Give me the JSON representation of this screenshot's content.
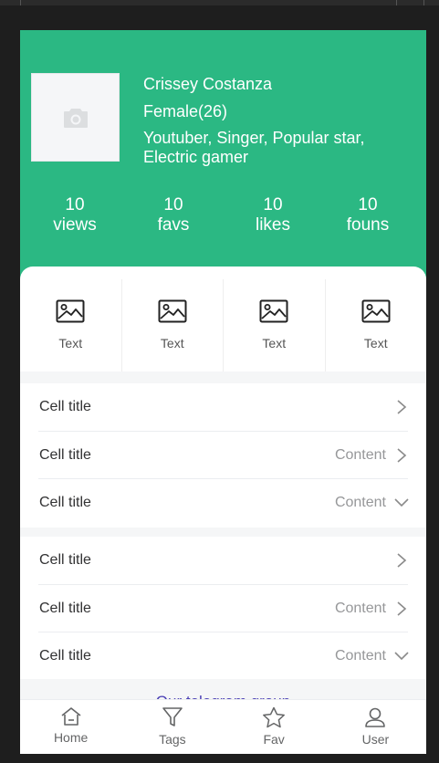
{
  "profile": {
    "avatar_icon": "camera-icon",
    "name": "Crissey Costanza",
    "gender": "Female(26)",
    "tags": "Youtuber, Singer, Popular star, Electric gamer"
  },
  "stats": [
    {
      "value": "10",
      "label": "views"
    },
    {
      "value": "10",
      "label": "favs"
    },
    {
      "value": "10",
      "label": "likes"
    },
    {
      "value": "10",
      "label": "founs"
    }
  ],
  "grid": [
    {
      "icon": "image-icon",
      "label": "Text"
    },
    {
      "icon": "image-icon",
      "label": "Text"
    },
    {
      "icon": "image-icon",
      "label": "Text"
    },
    {
      "icon": "image-icon",
      "label": "Text"
    }
  ],
  "cell_groups": [
    [
      {
        "title": "Cell title",
        "value": "",
        "arrow": "chevron-right-icon"
      },
      {
        "title": "Cell title",
        "value": "Content",
        "arrow": "chevron-right-icon"
      },
      {
        "title": "Cell title",
        "value": "Content",
        "arrow": "chevron-down-icon"
      }
    ],
    [
      {
        "title": "Cell title",
        "value": "",
        "arrow": "chevron-right-icon"
      },
      {
        "title": "Cell title",
        "value": "Content",
        "arrow": "chevron-right-icon"
      },
      {
        "title": "Cell title",
        "value": "Content",
        "arrow": "chevron-down-icon"
      }
    ]
  ],
  "link": {
    "label": "Our telegram group"
  },
  "tabbar": [
    {
      "icon": "home-icon",
      "label": "Home"
    },
    {
      "icon": "filter-icon",
      "label": "Tags"
    },
    {
      "icon": "star-icon",
      "label": "Fav"
    },
    {
      "icon": "user-icon",
      "label": "User"
    }
  ],
  "colors": {
    "header_bg": "#2bb883",
    "link": "#4a3fb5",
    "page_bg": "#f5f6f7"
  }
}
